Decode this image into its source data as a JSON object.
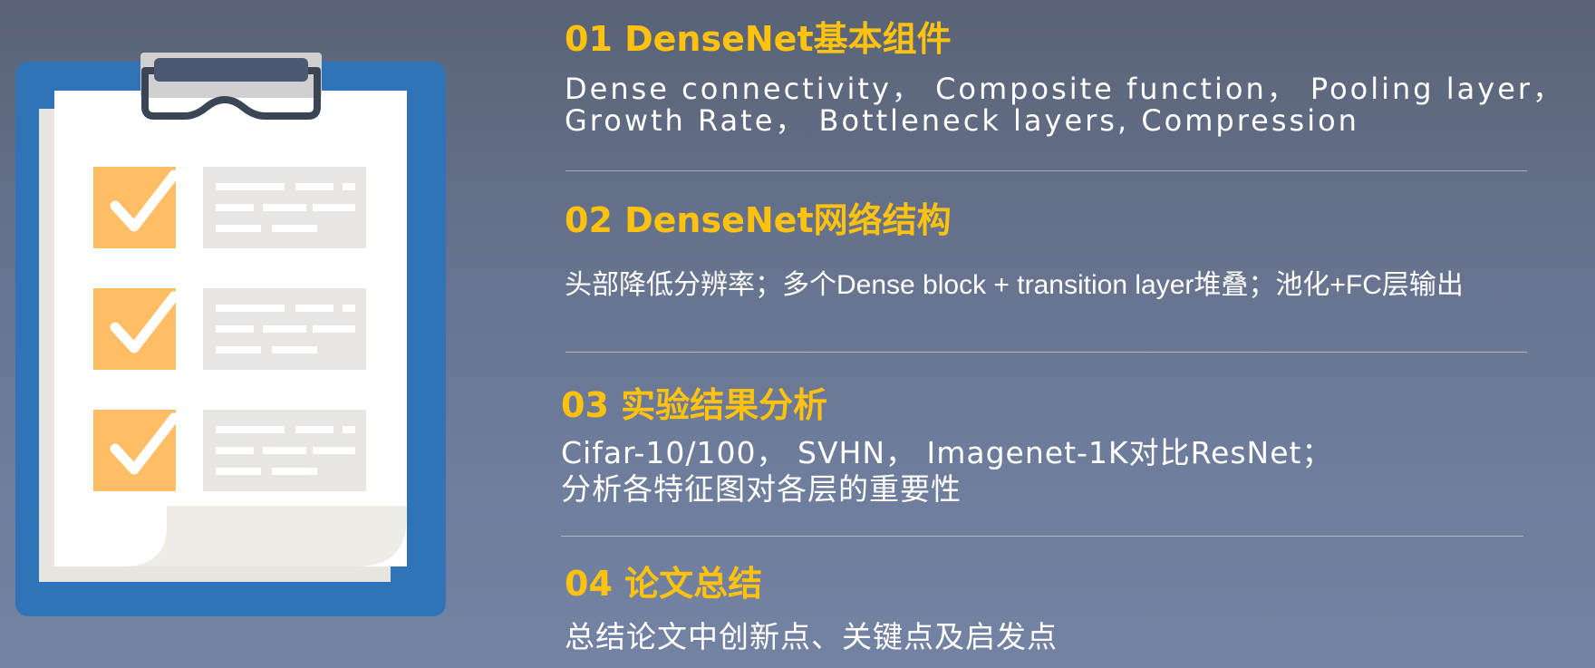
{
  "sections": [
    {
      "title": "01 DenseNet基本组件",
      "lines": [
        "Dense connectivity， Composite function， Pooling layer，",
        "Growth Rate， Bottleneck layers, Compression"
      ]
    },
    {
      "title": "02 DenseNet网络结构",
      "lines": [
        "头部降低分辨率；多个Dense block + transition layer堆叠；池化+FC层输出"
      ]
    },
    {
      "title": "03 实验结果分析",
      "lines": [
        "Cifar-10/100， SVHN， Imagenet-1K对比ResNet；",
        "分析各特征图对各层的重要性"
      ]
    },
    {
      "title": "04 论文总结",
      "lines": [
        "总结论文中创新点、关键点及启发点"
      ]
    }
  ],
  "illustration": {
    "icon": "clipboard-checklist-icon",
    "checked_items": 3
  },
  "colors": {
    "background_top": "#596276",
    "background_bottom": "#7483a3",
    "title": "#ffc20e",
    "text": "#ffffff",
    "clipboard_board": "#2f74b8",
    "clip": "#3b4556",
    "checkbox": "#ffbd66",
    "text_placeholder": "#e8e6e3"
  }
}
